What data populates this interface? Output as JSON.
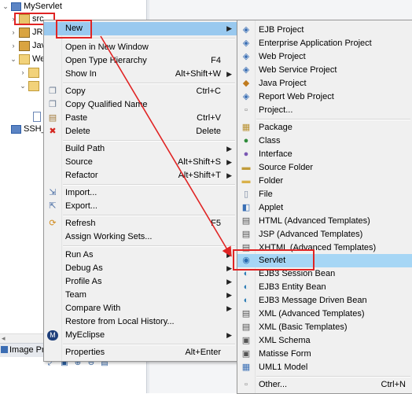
{
  "tree": {
    "project": "MyServlet",
    "src": "src",
    "child_jre": "JRI",
    "child_java": "Jav",
    "child_web": "We",
    "other_project": "SSH_Bea"
  },
  "bottom_tab": {
    "label": "Image Pr"
  },
  "context_menu": {
    "new_label": "New",
    "items": [
      {
        "label": "Open in New Window",
        "shortcut": ""
      },
      {
        "label": "Open Type Hierarchy",
        "shortcut": "F4"
      },
      {
        "label": "Show In",
        "shortcut": "Alt+Shift+W"
      },
      {
        "label": "Copy",
        "shortcut": "Ctrl+C"
      },
      {
        "label": "Copy Qualified Name",
        "shortcut": ""
      },
      {
        "label": "Paste",
        "shortcut": "Ctrl+V"
      },
      {
        "label": "Delete",
        "shortcut": "Delete"
      },
      {
        "label": "Build Path",
        "shortcut": ""
      },
      {
        "label": "Source",
        "shortcut": "Alt+Shift+S"
      },
      {
        "label": "Refactor",
        "shortcut": "Alt+Shift+T"
      },
      {
        "label": "Import...",
        "shortcut": ""
      },
      {
        "label": "Export...",
        "shortcut": ""
      },
      {
        "label": "Refresh",
        "shortcut": "F5"
      },
      {
        "label": "Assign Working Sets...",
        "shortcut": ""
      },
      {
        "label": "Run As",
        "shortcut": ""
      },
      {
        "label": "Debug As",
        "shortcut": ""
      },
      {
        "label": "Profile As",
        "shortcut": ""
      },
      {
        "label": "Team",
        "shortcut": ""
      },
      {
        "label": "Compare With",
        "shortcut": ""
      },
      {
        "label": "Restore from Local History...",
        "shortcut": ""
      },
      {
        "label": "MyEclipse",
        "shortcut": ""
      },
      {
        "label": "Properties",
        "shortcut": "Alt+Enter"
      }
    ]
  },
  "new_submenu": {
    "items": [
      {
        "label": "EJB Project"
      },
      {
        "label": "Enterprise Application Project"
      },
      {
        "label": "Web Project"
      },
      {
        "label": "Web Service Project"
      },
      {
        "label": "Java Project"
      },
      {
        "label": "Report Web Project"
      },
      {
        "label": "Project..."
      },
      {
        "label": "Package"
      },
      {
        "label": "Class"
      },
      {
        "label": "Interface"
      },
      {
        "label": "Source Folder"
      },
      {
        "label": "Folder"
      },
      {
        "label": "File"
      },
      {
        "label": "Applet"
      },
      {
        "label": "HTML (Advanced Templates)"
      },
      {
        "label": "JSP (Advanced Templates)"
      },
      {
        "label": "XHTML (Advanced Templates)"
      },
      {
        "label": "Servlet"
      },
      {
        "label": "EJB3 Session Bean"
      },
      {
        "label": "EJB3 Entity Bean"
      },
      {
        "label": "EJB3 Message Driven Bean"
      },
      {
        "label": "XML (Advanced Templates)"
      },
      {
        "label": "XML (Basic Templates)"
      },
      {
        "label": "XML Schema"
      },
      {
        "label": "Matisse Form"
      },
      {
        "label": "UML1 Model"
      },
      {
        "label": "Other...",
        "shortcut": "Ctrl+N"
      }
    ]
  },
  "colors": {
    "highlight": "#a6d6f5",
    "annotation": "#e02424"
  }
}
